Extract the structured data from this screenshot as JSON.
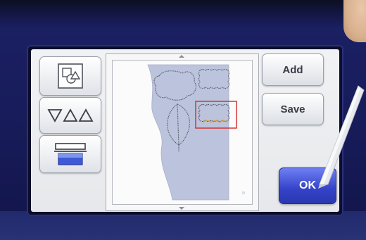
{
  "device": {
    "left_tools": [
      {
        "name": "layout-tool",
        "icon": "shapes-arrange-icon"
      },
      {
        "name": "shape-tool",
        "icon": "triangles-icon"
      },
      {
        "name": "scan-tool",
        "icon": "scanner-icon"
      }
    ],
    "right_buttons": {
      "add_label": "Add",
      "save_label": "Save",
      "ok_label": "OK"
    },
    "colors": {
      "ok_button": "#3443c8",
      "selection_outline": "#d22a2a",
      "material": "#bcc3dc"
    }
  }
}
